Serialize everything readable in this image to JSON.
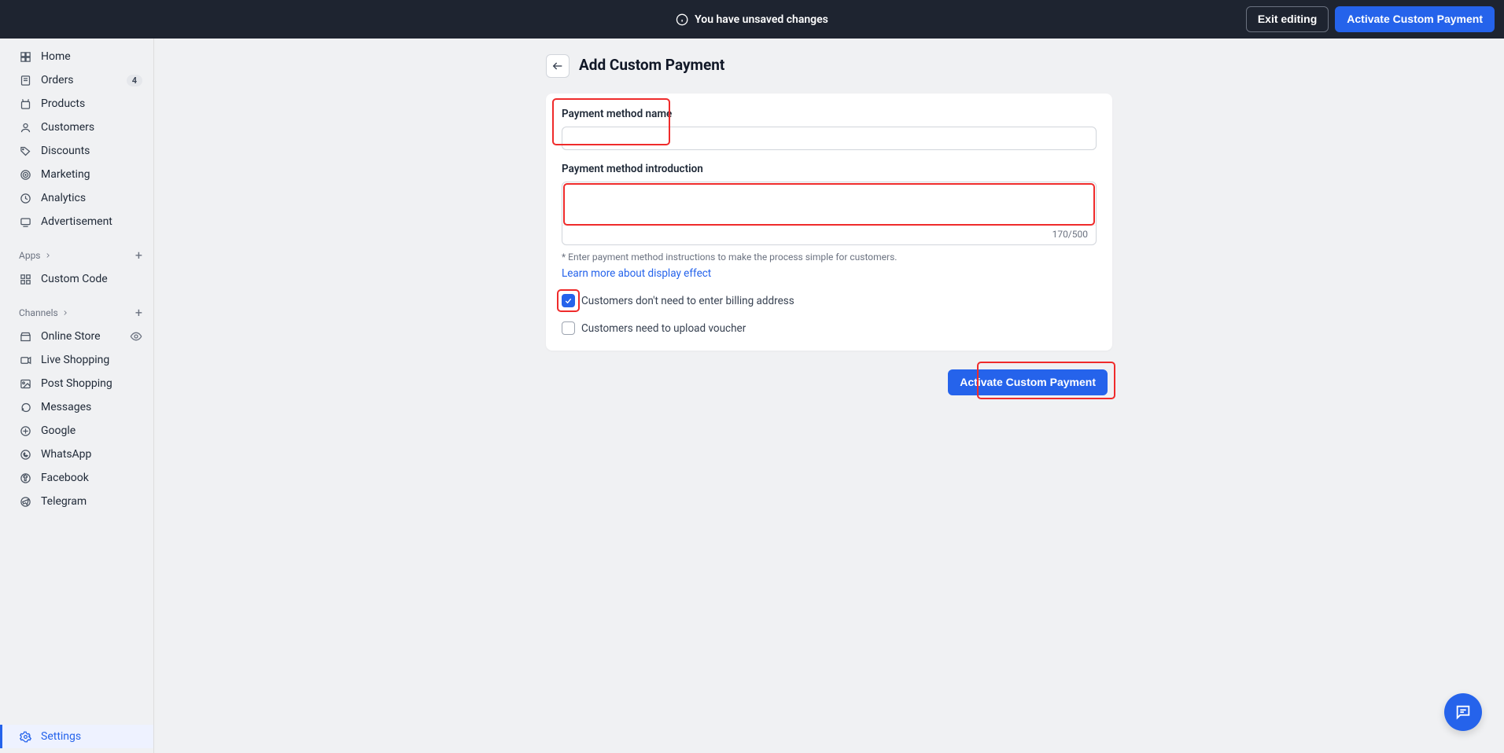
{
  "topbar": {
    "unsaved_message": "You have unsaved changes",
    "exit_label": "Exit editing",
    "activate_label": "Activate Custom Payment"
  },
  "sidebar": {
    "main_items": [
      {
        "label": "Home",
        "icon": "home"
      },
      {
        "label": "Orders",
        "icon": "orders",
        "badge": "4"
      },
      {
        "label": "Products",
        "icon": "products"
      },
      {
        "label": "Customers",
        "icon": "customers"
      },
      {
        "label": "Discounts",
        "icon": "discounts"
      },
      {
        "label": "Marketing",
        "icon": "marketing"
      },
      {
        "label": "Analytics",
        "icon": "analytics"
      },
      {
        "label": "Advertisement",
        "icon": "advertisement"
      }
    ],
    "apps_label": "Apps",
    "apps_items": [
      {
        "label": "Custom Code",
        "icon": "custom-code"
      }
    ],
    "channels_label": "Channels",
    "channels_items": [
      {
        "label": "Online Store",
        "icon": "online-store",
        "eye": true
      },
      {
        "label": "Live Shopping",
        "icon": "live-shopping"
      },
      {
        "label": "Post Shopping",
        "icon": "post-shopping"
      },
      {
        "label": "Messages",
        "icon": "messages"
      },
      {
        "label": "Google",
        "icon": "google"
      },
      {
        "label": "WhatsApp",
        "icon": "whatsapp"
      },
      {
        "label": "Facebook",
        "icon": "facebook"
      },
      {
        "label": "Telegram",
        "icon": "telegram"
      }
    ],
    "settings_label": "Settings"
  },
  "page": {
    "title": "Add Custom Payment"
  },
  "form": {
    "name_label": "Payment method name",
    "name_value": "",
    "intro_label": "Payment method introduction",
    "intro_value": "",
    "char_count": "170/500",
    "hint": "* Enter payment method instructions to make the process simple for customers.",
    "learn_more": "Learn more about display effect",
    "billing_checkbox_label": "Customers don't need to enter billing address",
    "billing_checkbox_checked": true,
    "voucher_checkbox_label": "Customers need to upload voucher",
    "voucher_checkbox_checked": false
  },
  "actions": {
    "activate_label": "Activate Custom Payment"
  }
}
